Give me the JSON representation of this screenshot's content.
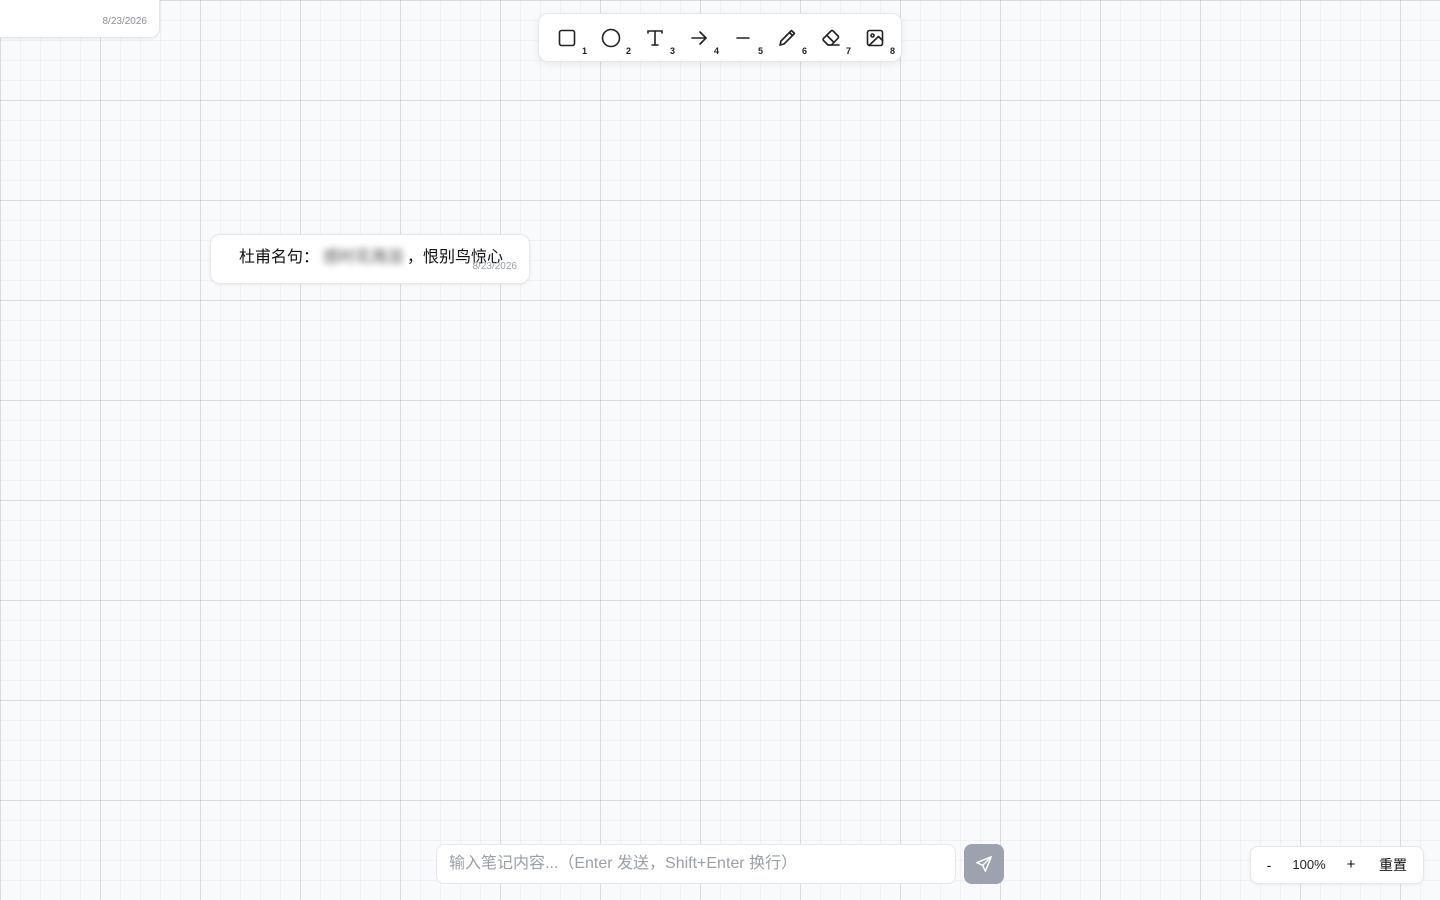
{
  "notes": [
    {
      "date": "8/23/2026"
    },
    {
      "prefix": "杜甫名句：",
      "blurred": "感时花溅泪",
      "suffix": "，恨别鸟惊心",
      "date": "8/23/2026"
    }
  ],
  "toolbar": {
    "tools": [
      {
        "icon": "rectangle-icon",
        "hotkey": "1"
      },
      {
        "icon": "circle-icon",
        "hotkey": "2"
      },
      {
        "icon": "text-icon",
        "hotkey": "3"
      },
      {
        "icon": "arrow-icon",
        "hotkey": "4"
      },
      {
        "icon": "line-icon",
        "hotkey": "5"
      },
      {
        "icon": "pencil-icon",
        "hotkey": "6"
      },
      {
        "icon": "eraser-icon",
        "hotkey": "7"
      },
      {
        "icon": "image-icon",
        "hotkey": "8"
      }
    ]
  },
  "composer": {
    "placeholder": "输入笔记内容...（Enter 发送，Shift+Enter 换行）",
    "send_icon": "send-icon",
    "send_color": "#9ca3af"
  },
  "zoom": {
    "minus": "-",
    "level": "100%",
    "plus": "+",
    "reset": "重置"
  },
  "colors": {
    "canvas": "#f9fafb",
    "panel": "#ffffff",
    "border": "#e5e7eb"
  }
}
